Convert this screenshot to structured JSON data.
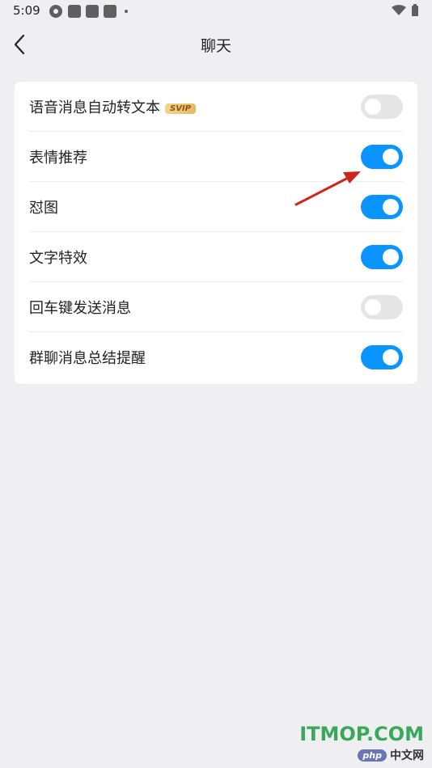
{
  "status_bar": {
    "time": "5:09"
  },
  "nav": {
    "title": "聊天"
  },
  "settings": {
    "items": [
      {
        "label": "语音消息自动转文本",
        "badge": "SVIP",
        "on": false
      },
      {
        "label": "表情推荐",
        "on": true
      },
      {
        "label": "怼图",
        "on": true
      },
      {
        "label": "文字特效",
        "on": true
      },
      {
        "label": "回车键发送消息",
        "on": false
      },
      {
        "label": "群聊消息总结提醒",
        "on": true
      }
    ]
  },
  "colors": {
    "toggle_on": "#0a94ff",
    "toggle_off": "#e5e5e7",
    "annotation_arrow": "#d0251c"
  },
  "watermark": {
    "main": "ITMOP.COM",
    "logo": "php",
    "text": "中文网"
  }
}
